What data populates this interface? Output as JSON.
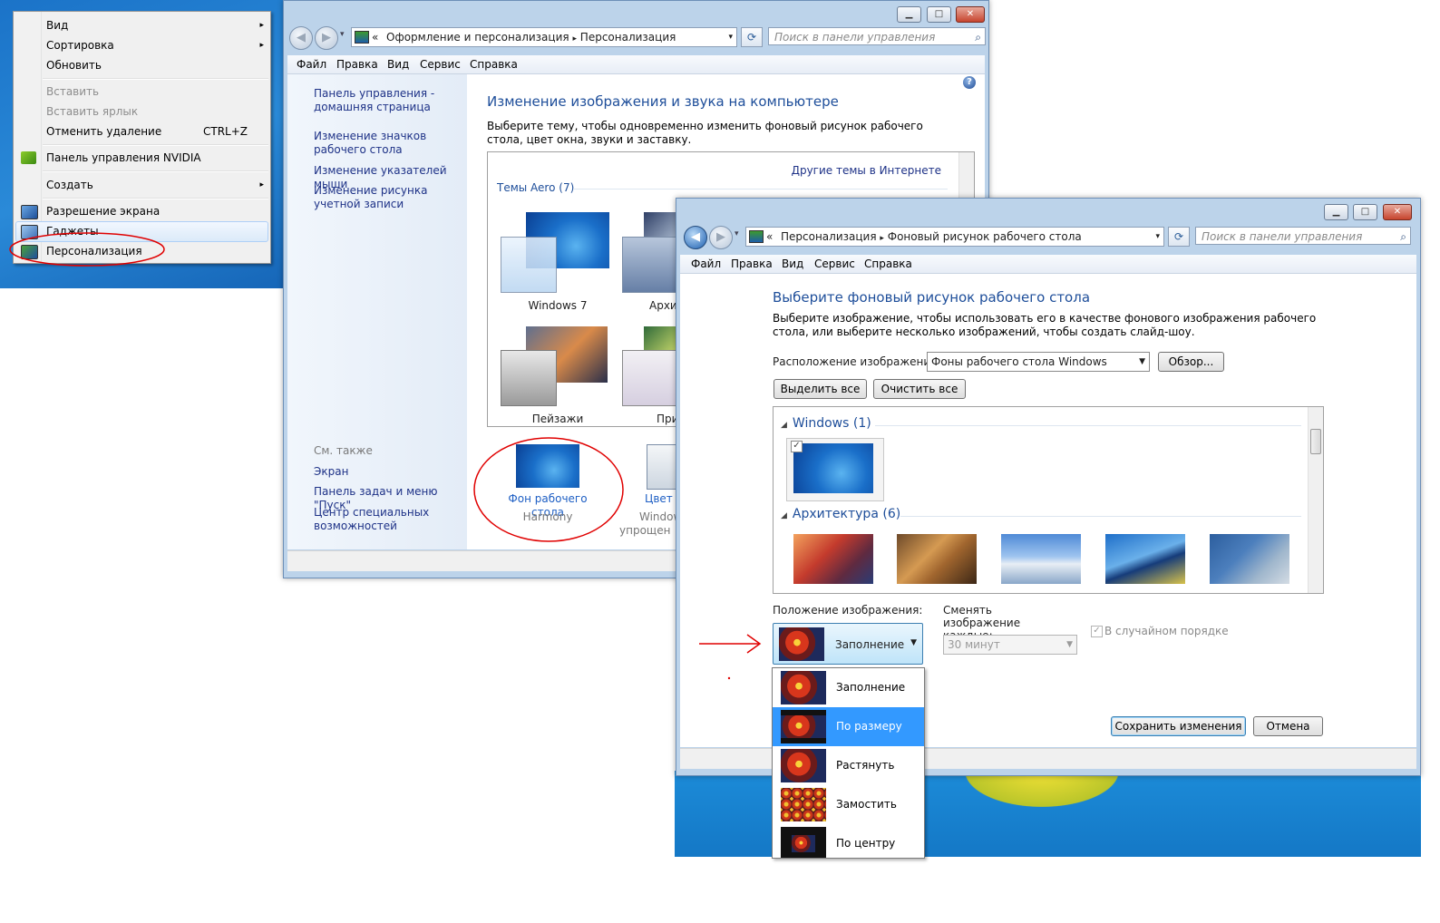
{
  "context_menu": {
    "items": [
      {
        "label": "Вид",
        "arrow": "▸"
      },
      {
        "label": "Сортировка",
        "arrow": "▸"
      },
      {
        "label": "Обновить"
      },
      {
        "label": "Вставить"
      },
      {
        "label": "Вставить ярлык"
      },
      {
        "label": "Отменить удаление",
        "shortcut": "CTRL+Z"
      },
      {
        "label": "Панель управления NVIDIA"
      },
      {
        "label": "Создать",
        "arrow": "▸"
      },
      {
        "label": "Разрешение экрана"
      },
      {
        "label": "Гаджеты"
      },
      {
        "label": "Персонализация"
      }
    ]
  },
  "window1": {
    "title_buttons": {
      "min": "▁",
      "max": "□",
      "close": "✕"
    },
    "nav": {
      "back": "◀",
      "forward": "▶",
      "recent": "▾"
    },
    "address": {
      "prefix": "«",
      "path1": "Оформление и персонализация",
      "sep": "▸",
      "path2": "Персонализация",
      "dropdown": "▾"
    },
    "refresh": "⟳",
    "search": {
      "placeholder": "Поиск в панели управления",
      "icon": "⌕"
    },
    "menu": [
      "Файл",
      "Правка",
      "Вид",
      "Сервис",
      "Справка"
    ],
    "sidebar": {
      "home": "Панель управления - домашняя страница",
      "links": [
        "Изменение значков рабочего стола",
        "Изменение указателей мыши",
        "Изменение рисунка учетной записи"
      ],
      "see_also": "См. также",
      "see_links": [
        "Экран",
        "Панель задач и меню \"Пуск\"",
        "Центр специальных возможностей"
      ]
    },
    "help": "?",
    "heading": "Изменение изображения и звука на компьютере",
    "description": "Выберите тему, чтобы одновременно изменить фоновый рисунок рабочего стола, цвет окна, звуки и заставку.",
    "online_link": "Другие темы в Интернете",
    "aero_group": "Темы Aero (7)",
    "themes": [
      "Windows 7",
      "Архит",
      "Пейзажи",
      "При"
    ],
    "bottom": {
      "background_label": "Фон рабочего стола",
      "background_value": "Harmony",
      "color_label": "Цвет",
      "color_value": "Window",
      "color_value2": "упрощен"
    }
  },
  "window2": {
    "title_buttons": {
      "min": "▁",
      "max": "□",
      "close": "✕"
    },
    "nav": {
      "back": "◀",
      "forward": "▶",
      "recent": "▾"
    },
    "address": {
      "prefix": "«",
      "path1": "Персонализация",
      "sep": "▸",
      "path2": "Фоновый рисунок рабочего стола",
      "dropdown": "▾"
    },
    "refresh": "⟳",
    "search": {
      "placeholder": "Поиск в панели управления",
      "icon": "⌕"
    },
    "menu": [
      "Файл",
      "Правка",
      "Вид",
      "Сервис",
      "Справка"
    ],
    "heading": "Выберите фоновый рисунок рабочего стола",
    "description": "Выберите изображение, чтобы использовать его в качестве фонового изображения рабочего стола, или выберите несколько изображений, чтобы создать слайд-шоу.",
    "location_label": "Расположение изображения:",
    "location_value": "Фоны рабочего стола Windows",
    "browse": "Обзор...",
    "select_all": "Выделить все",
    "clear_all": "Очистить все",
    "groups": [
      {
        "title": "Windows (1)",
        "tri": "◢"
      },
      {
        "title": "Архитектура (6)",
        "tri": "◢"
      }
    ],
    "checkmark": "✓",
    "position_label": "Положение изображения:",
    "position_value": "Заполнение",
    "change_label": "Сменять изображение каждые:",
    "change_value": "30 минут",
    "shuffle_label": "В случайном порядке",
    "position_options": [
      {
        "label": "Заполнение",
        "selected": false
      },
      {
        "label": "По размеру",
        "selected": true
      },
      {
        "label": "Растянуть",
        "selected": false
      },
      {
        "label": "Замостить",
        "selected": false
      },
      {
        "label": "По центру",
        "selected": false
      }
    ],
    "save": "Сохранить изменения",
    "cancel": "Отмена"
  },
  "annotation_color": "#e00000"
}
